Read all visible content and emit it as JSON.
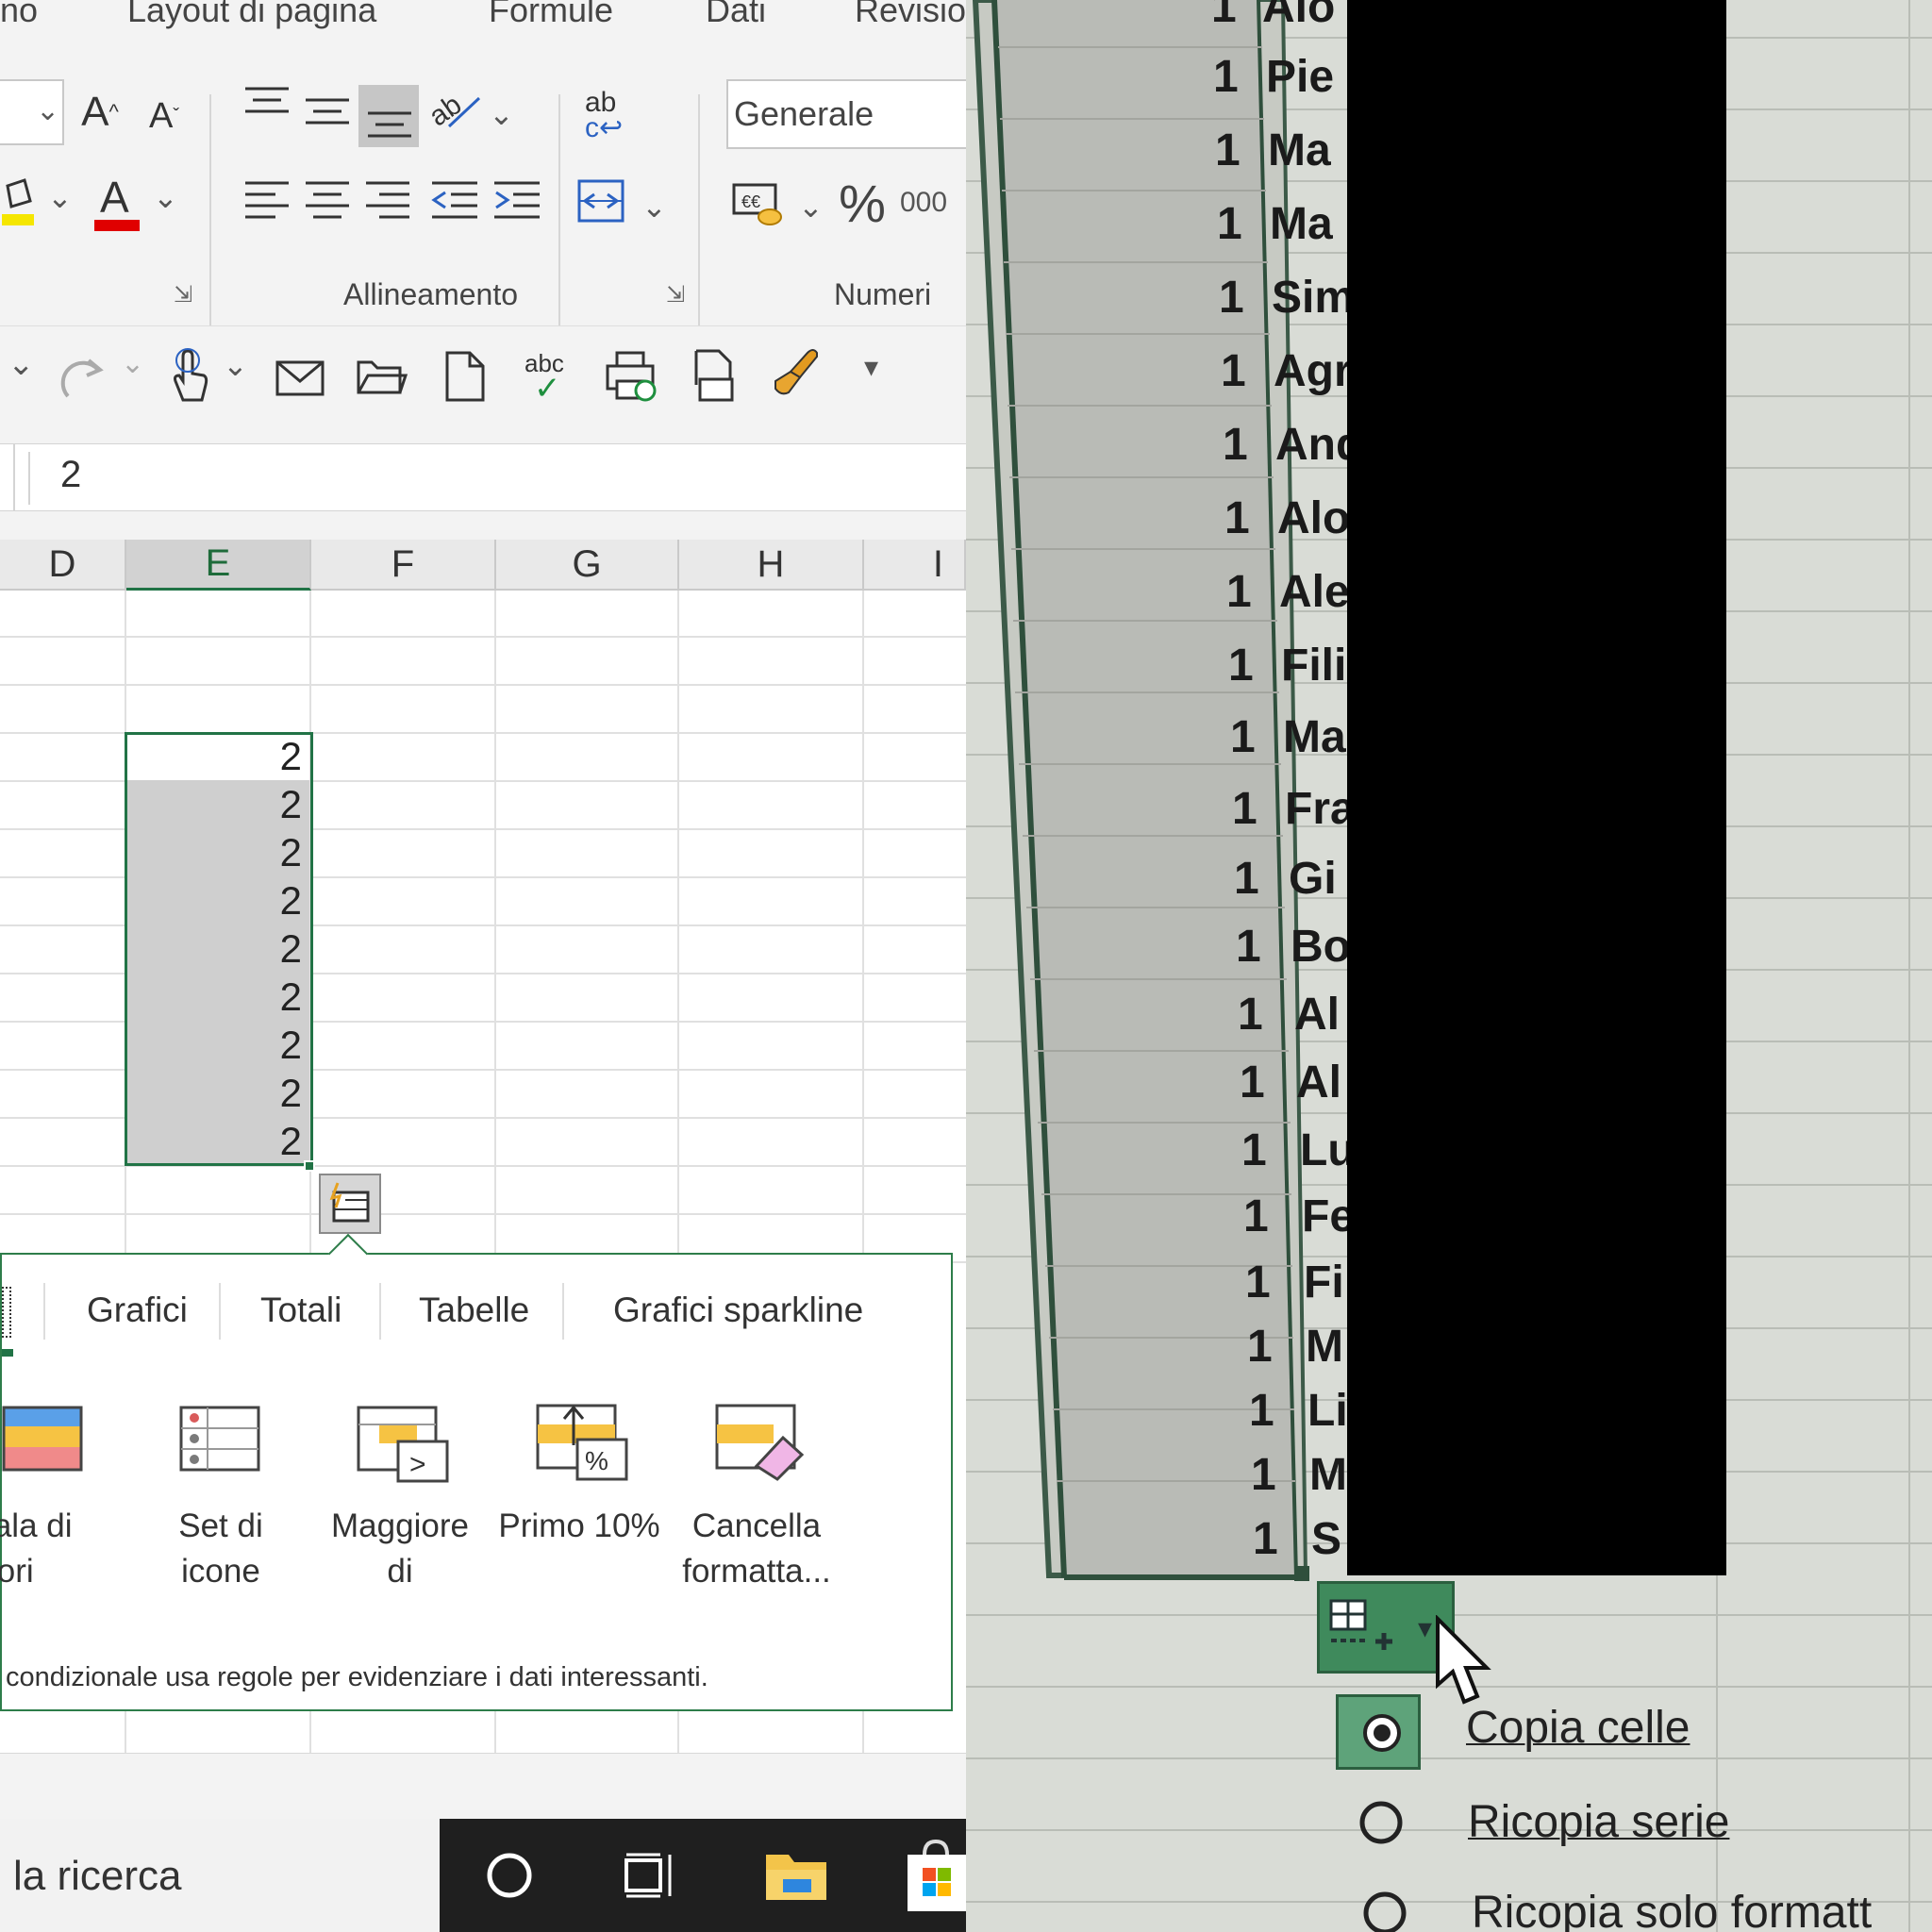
{
  "ribbon_tabs": [
    "no",
    "Layout di pagina",
    "Formule",
    "Dati",
    "Revisio"
  ],
  "number_format": "Generale",
  "group_labels": {
    "alignment": "Allineamento",
    "numbers": "Numeri"
  },
  "ribbon_small": {
    "ab": "ab",
    "thousands": "000",
    "abc": "abc"
  },
  "formula_value": "2",
  "columns": [
    "D",
    "E",
    "F",
    "G",
    "H",
    "I"
  ],
  "cells": [
    "2",
    "2",
    "2",
    "2",
    "2",
    "2",
    "2",
    "2",
    "2"
  ],
  "quick_analysis": {
    "tabs": [
      "Grafici",
      "Totali",
      "Tabelle",
      "Grafici sparkline"
    ],
    "items": [
      {
        "line1": "Scala di",
        "line2": "colori",
        "icon": "color-scale-icon"
      },
      {
        "line1": "Set di",
        "line2": "icone",
        "icon": "icon-set-icon"
      },
      {
        "line1": "Maggiore",
        "line2": "di",
        "icon": "greater-than-icon"
      },
      {
        "line1": "Primo 10%",
        "line2": "",
        "icon": "top-10-icon"
      },
      {
        "line1": "Cancella",
        "line2": "formatta...",
        "icon": "clear-format-icon"
      }
    ],
    "description": "condizionale usa regole per evidenziare i dati interessanti."
  },
  "taskbar": {
    "search_text": "la ricerca"
  },
  "photo": {
    "rows": [
      {
        "num": "1",
        "name": "Alo"
      },
      {
        "num": "1",
        "name": "Pie"
      },
      {
        "num": "1",
        "name": "Ma"
      },
      {
        "num": "1",
        "name": "Ma"
      },
      {
        "num": "1",
        "name": "Sim"
      },
      {
        "num": "1",
        "name": "Agr"
      },
      {
        "num": "1",
        "name": "And"
      },
      {
        "num": "1",
        "name": "Alo"
      },
      {
        "num": "1",
        "name": "Ale"
      },
      {
        "num": "1",
        "name": "Fili"
      },
      {
        "num": "1",
        "name": "Ma"
      },
      {
        "num": "1",
        "name": "Fra"
      },
      {
        "num": "1",
        "name": "Gi"
      },
      {
        "num": "1",
        "name": "Bo"
      },
      {
        "num": "1",
        "name": "Al"
      },
      {
        "num": "1",
        "name": "Al"
      },
      {
        "num": "1",
        "name": "Lu"
      },
      {
        "num": "1",
        "name": "Fe"
      },
      {
        "num": "1",
        "name": "Fi"
      },
      {
        "num": "1",
        "name": "M"
      },
      {
        "num": "1",
        "name": "Li"
      },
      {
        "num": "1",
        "name": "M"
      },
      {
        "num": "1",
        "name": "S"
      }
    ],
    "options": [
      "Copia celle",
      "Ricopia serie",
      "Ricopia solo formatt"
    ]
  },
  "colors": {
    "excel_green": "#217346",
    "selection_gray": "#cfcfcf",
    "taskbar": "#1f1f1f"
  }
}
